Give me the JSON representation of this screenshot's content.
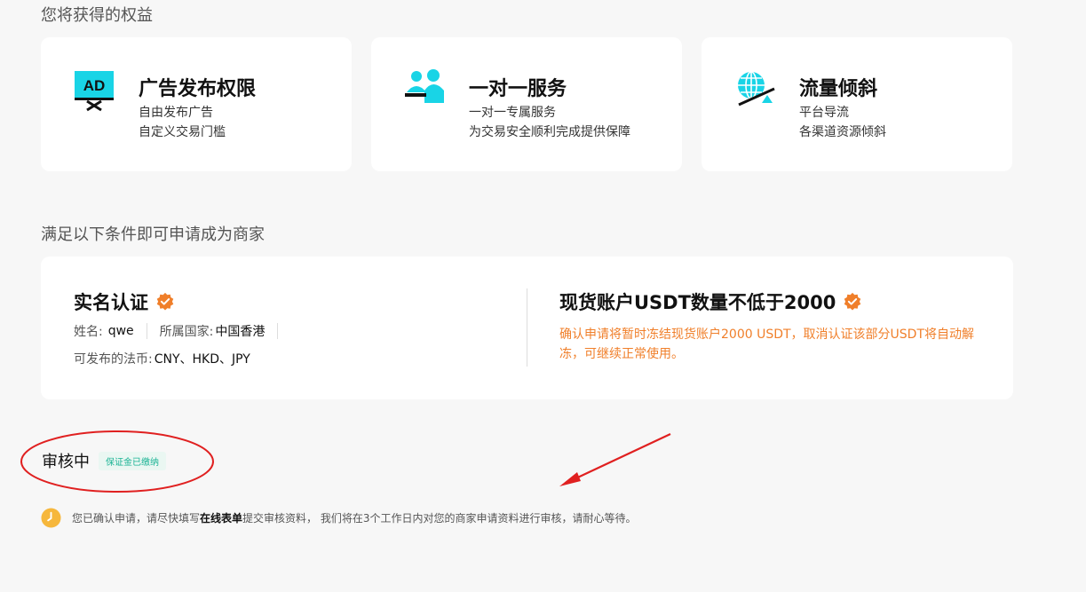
{
  "benefits_section": {
    "title": "您将获得的权益",
    "cards": [
      {
        "icon": "ad-icon",
        "title": "广告发布权限",
        "line1": "自由发布广告",
        "line2": "自定义交易门槛"
      },
      {
        "icon": "people-icon",
        "title": "一对一服务",
        "line1": "一对一专属服务",
        "line2": "为交易安全顺利完成提供保障"
      },
      {
        "icon": "globe-icon",
        "title": "流量倾斜",
        "line1": "平台导流",
        "line2": "各渠道资源倾斜"
      }
    ]
  },
  "conditions_section": {
    "title": "满足以下条件即可申请成为商家",
    "identity": {
      "title": "实名认证",
      "name_label": "姓名:",
      "name_value": "qwe",
      "country_label": "所属国家:",
      "country_value": "中国香港",
      "fiat_label": "可发布的法币:",
      "fiat_value": "CNY、HKD、JPY"
    },
    "balance": {
      "title": "现货账户USDT数量不低于2000",
      "note": "确认申请将暂时冻结现货账户2000 USDT，取消认证该部分USDT将自动解冻，可继续正常使用。"
    }
  },
  "status": {
    "label": "审核中",
    "badge": "保证金已缴纳"
  },
  "notice": {
    "before": "您已确认申请，请尽快填写",
    "link": "在线表单",
    "after": "提交审核资料， 我们将在3个工作日内对您的商家申请资料进行审核，请耐心等待。"
  },
  "colors": {
    "accent_orange": "#f07f2a",
    "icon_cyan": "#19d4e6",
    "badge_green": "#1ab394",
    "annotation_red": "#e02020"
  }
}
